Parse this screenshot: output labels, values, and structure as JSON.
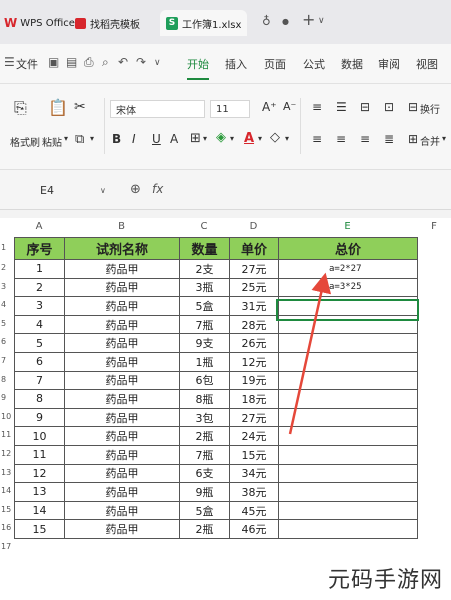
{
  "titlebar": {
    "tabs": [
      "WPS Office",
      "找稻壳模板",
      "工作簿1.xlsx"
    ],
    "logo_letter": "W",
    "sheet_logo_letter": "S",
    "add_label": "+"
  },
  "menubar": {
    "file_label": "文件",
    "items": [
      "开始",
      "插入",
      "页面",
      "公式",
      "数据",
      "审阅",
      "视图"
    ],
    "active": "开始"
  },
  "ribbon": {
    "paste_format_label": "格式刷",
    "paste_label": "粘贴",
    "font_name": "宋体",
    "font_size": "11",
    "wrap_label": "换行",
    "merge_label": "合并",
    "bold": "B",
    "italic": "I",
    "underline": "U",
    "strike": "A",
    "font_color_letter": "A"
  },
  "formulabar": {
    "cell_ref": "E4",
    "fx_label": "fx"
  },
  "grid": {
    "columns": [
      "A",
      "B",
      "C",
      "D",
      "E",
      "F"
    ],
    "selected_column": "E",
    "row_numbers": [
      "1",
      "2",
      "3",
      "4",
      "5",
      "6",
      "7",
      "8",
      "9",
      "10",
      "11",
      "12",
      "13",
      "14",
      "15",
      "16",
      "17"
    ],
    "header": [
      "序号",
      "试剂名称",
      "数量",
      "单价",
      "总价"
    ],
    "rows": [
      [
        "1",
        "药品甲",
        "2支",
        "27元",
        "a=2*27"
      ],
      [
        "2",
        "药品甲",
        "3瓶",
        "25元",
        "a=3*25"
      ],
      [
        "3",
        "药品甲",
        "5盒",
        "31元",
        ""
      ],
      [
        "4",
        "药品甲",
        "7瓶",
        "28元",
        ""
      ],
      [
        "5",
        "药品甲",
        "9支",
        "26元",
        ""
      ],
      [
        "6",
        "药品甲",
        "1瓶",
        "12元",
        ""
      ],
      [
        "7",
        "药品甲",
        "6包",
        "19元",
        ""
      ],
      [
        "8",
        "药品甲",
        "8瓶",
        "18元",
        ""
      ],
      [
        "9",
        "药品甲",
        "3包",
        "27元",
        ""
      ],
      [
        "10",
        "药品甲",
        "2瓶",
        "24元",
        ""
      ],
      [
        "11",
        "药品甲",
        "7瓶",
        "15元",
        ""
      ],
      [
        "12",
        "药品甲",
        "6支",
        "34元",
        ""
      ],
      [
        "13",
        "药品甲",
        "9瓶",
        "38元",
        ""
      ],
      [
        "14",
        "药品甲",
        "5盒",
        "45元",
        ""
      ],
      [
        "15",
        "药品甲",
        "2瓶",
        "46元",
        ""
      ]
    ],
    "header_color": "#8fcf5a",
    "arrow_color": "#e5483a",
    "selection_color": "#1e8a3f"
  },
  "watermark": "元码手游网"
}
